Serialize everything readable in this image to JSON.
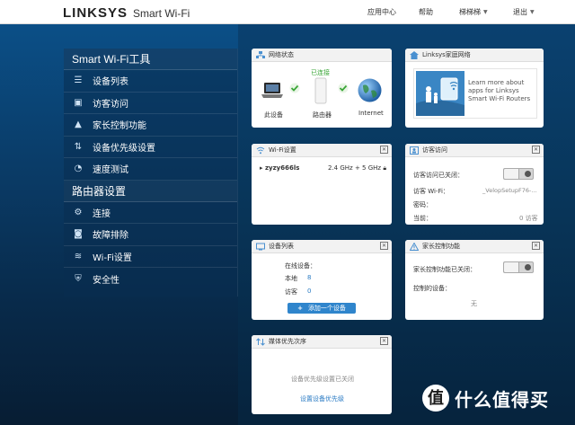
{
  "header": {
    "logo": "LINKSYS",
    "app_name": "Smart Wi-Fi",
    "nav": [
      {
        "label": "应用中心"
      },
      {
        "label": "帮助"
      },
      {
        "label": "梯梯梯"
      },
      {
        "label": "退出"
      }
    ]
  },
  "sidebar": {
    "section1_title": "Smart Wi-Fi工具",
    "section1_items": [
      {
        "label": "设备列表",
        "icon": "device-list-icon"
      },
      {
        "label": "访客访问",
        "icon": "guest-access-icon"
      },
      {
        "label": "家长控制功能",
        "icon": "warning-icon"
      },
      {
        "label": "设备优先级设置",
        "icon": "priority-icon"
      },
      {
        "label": "速度测试",
        "icon": "speed-test-icon"
      }
    ],
    "section2_title": "路由器设置",
    "section2_items": [
      {
        "label": "连接",
        "icon": "connectivity-icon"
      },
      {
        "label": "故障排除",
        "icon": "camera-icon"
      },
      {
        "label": "Wi-Fi设置",
        "icon": "wifi-icon"
      },
      {
        "label": "安全性",
        "icon": "shield-icon"
      }
    ]
  },
  "network_status": {
    "title": "网络状态",
    "connected_label": "已连接",
    "this_device": "此设备",
    "router": "路由器",
    "internet": "Internet"
  },
  "linksys_app": {
    "title": "Linksys家庭网络",
    "text": "Learn more about apps for Linksys Smart Wi-Fi Routers"
  },
  "wifi_settings": {
    "title": "Wi-Fi设置",
    "ssid": "zyzy666ls",
    "bands": "2.4 GHz + 5 GHz"
  },
  "guest_access": {
    "title": "访客访问",
    "status_label": "访客访问已关闭：",
    "wifi_label": "访客 Wi-Fi：",
    "wifi_value": "_VelopSetupF76-...",
    "password_label": "密码：",
    "current_label": "当前：",
    "current_value": "0 访客"
  },
  "device_list": {
    "title": "设备列表",
    "online_label": "在线设备：",
    "local_label": "本地",
    "local_value": "8",
    "guest_label": "访客",
    "guest_value": "0",
    "add_button": "添加一个设备"
  },
  "parental": {
    "title": "家长控制功能",
    "status_label": "家长控制功能已关闭：",
    "controlled_label": "控制的设备：",
    "none": "无"
  },
  "media_priority": {
    "title": "媒体优先次序",
    "status_text": "设备优先级设置已关闭",
    "link": "设置设备优先级"
  },
  "watermark": {
    "symbol": "值",
    "text": "什么值得买"
  }
}
